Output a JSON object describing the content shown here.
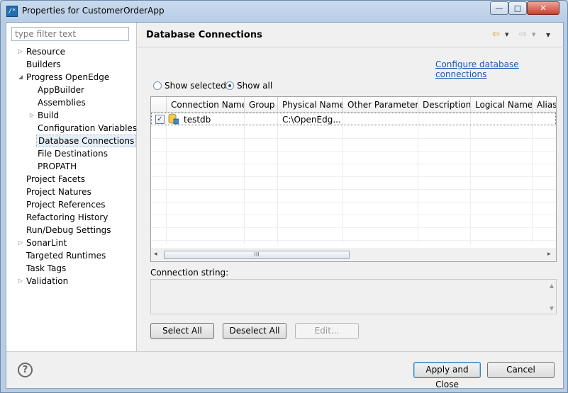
{
  "window": {
    "title": "Properties for CustomerOrderApp",
    "min_glyph": "—",
    "max_glyph": "□",
    "close_glyph": "✕"
  },
  "filter": {
    "placeholder": "type filter text"
  },
  "tree": [
    {
      "label": "Resource",
      "arrow": "▷"
    },
    {
      "label": "Builders",
      "arrow": ""
    },
    {
      "label": "Progress OpenEdge",
      "arrow": "◢"
    },
    {
      "label": "AppBuilder",
      "arrow": ""
    },
    {
      "label": "Assemblies",
      "arrow": ""
    },
    {
      "label": "Build",
      "arrow": "▷"
    },
    {
      "label": "Configuration Variables",
      "arrow": ""
    },
    {
      "label": "Database Connections",
      "arrow": ""
    },
    {
      "label": "File Destinations",
      "arrow": ""
    },
    {
      "label": "PROPATH",
      "arrow": ""
    },
    {
      "label": "Project Facets",
      "arrow": ""
    },
    {
      "label": "Project Natures",
      "arrow": ""
    },
    {
      "label": "Project References",
      "arrow": ""
    },
    {
      "label": "Refactoring History",
      "arrow": ""
    },
    {
      "label": "Run/Debug Settings",
      "arrow": ""
    },
    {
      "label": "SonarLint",
      "arrow": "▷"
    },
    {
      "label": "Targeted Runtimes",
      "arrow": ""
    },
    {
      "label": "Task Tags",
      "arrow": ""
    },
    {
      "label": "Validation",
      "arrow": "▷"
    }
  ],
  "page": {
    "title": "Database Connections",
    "nav_back": "⇦",
    "nav_forward": "⇨",
    "menu_glyph": "▾",
    "configure_link": "Configure database connections",
    "show_selected": "Show selected",
    "show_all": "Show all"
  },
  "table": {
    "columns": [
      "Connection Name",
      "Group",
      "Physical Name",
      "Other Parameters",
      "Description",
      "Logical Name",
      "Alias"
    ],
    "rows": [
      {
        "checked": "✓",
        "name": "testdb",
        "group": "",
        "physical": "C:\\OpenEdg...",
        "other": "",
        "description": "",
        "logical": "",
        "alias": ""
      }
    ],
    "scroll_left": "◂",
    "scroll_right": "▸",
    "thumb_grip": "III"
  },
  "connection": {
    "label": "Connection string:",
    "value": ""
  },
  "buttons": {
    "select_all": "Select All",
    "deselect_all": "Deselect All",
    "edit": "Edit...",
    "apply_close": "Apply and Close",
    "cancel": "Cancel",
    "help": "?"
  },
  "colors": {
    "link": "#1a56b5",
    "selection": "#e5eef9",
    "title_bar": "#c9daee",
    "close_button": "#c7412e"
  }
}
